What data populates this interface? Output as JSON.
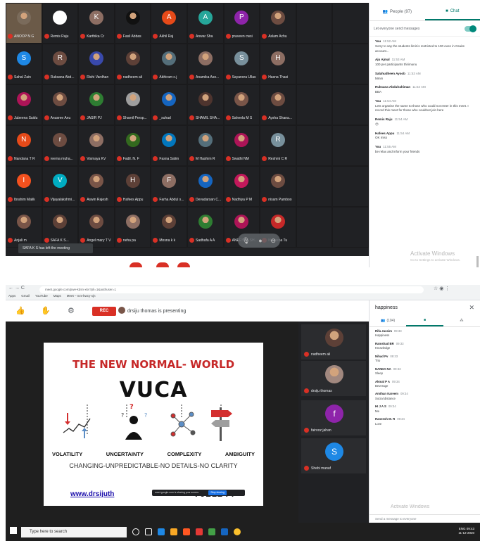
{
  "top": {
    "participants": [
      {
        "name": "ANOOP N G",
        "initial": "",
        "color": "#7a6b5b",
        "photo": true
      },
      {
        "name": "Remis Raju",
        "initial": "",
        "color": "#ffffff",
        "photo": false
      },
      {
        "name": "Karthika Cr",
        "initial": "K",
        "color": "#8d6e63",
        "photo": false
      },
      {
        "name": "Fasil Abbas",
        "initial": "",
        "color": "#111111",
        "photo": true
      },
      {
        "name": "Akhil Raj",
        "initial": "A",
        "color": "#e64a19",
        "photo": false
      },
      {
        "name": "Anwar Sha",
        "initial": "A",
        "color": "#26a69a",
        "photo": false
      },
      {
        "name": "praveen cwsi",
        "initial": "P",
        "color": "#8e24aa",
        "photo": false
      },
      {
        "name": "Aslam Achu",
        "initial": "",
        "color": "#6d4c41",
        "photo": true
      },
      {
        "name": "",
        "initial": "",
        "color": "#202124",
        "photo": false
      },
      {
        "name": "",
        "initial": "",
        "color": "#202124",
        "photo": false
      },
      {
        "name": "Sahal Zain",
        "initial": "S",
        "color": "#1e88e5",
        "photo": false
      },
      {
        "name": "Ruksana Abd...",
        "initial": "R",
        "color": "#6d4c41",
        "photo": false
      },
      {
        "name": "Rishi Vardhan",
        "initial": "",
        "color": "#3949ab",
        "photo": true
      },
      {
        "name": "nadheem ali",
        "initial": "",
        "color": "#5d4037",
        "photo": true
      },
      {
        "name": "Abhiram c.j",
        "initial": "",
        "color": "#546e7a",
        "photo": true
      },
      {
        "name": "Anamika Aso...",
        "initial": "",
        "color": "#8d6e63",
        "photo": true
      },
      {
        "name": "Sayanora Ullas",
        "initial": "S",
        "color": "#78909c",
        "photo": false
      },
      {
        "name": "Hasna Thasi",
        "initial": "H",
        "color": "#8d6e63",
        "photo": false
      },
      {
        "name": "",
        "initial": "",
        "color": "#202124",
        "photo": false
      },
      {
        "name": "",
        "initial": "",
        "color": "#202124",
        "photo": false
      },
      {
        "name": "Jubeena Saidu",
        "initial": "",
        "color": "#ad1457",
        "photo": true
      },
      {
        "name": "Anusree Anu",
        "initial": "",
        "color": "#6d4c41",
        "photo": true
      },
      {
        "name": "JASIR PJ",
        "initial": "",
        "color": "#2e7d32",
        "photo": true
      },
      {
        "name": "Shamil Persp...",
        "initial": "",
        "color": "#9e9e9e",
        "photo": true
      },
      {
        "name": "_suhad",
        "initial": "",
        "color": "#1565c0",
        "photo": true
      },
      {
        "name": "SHAMIL SHA...",
        "initial": "",
        "color": "#4e342e",
        "photo": true
      },
      {
        "name": "Saheela M S",
        "initial": "",
        "color": "#795548",
        "photo": true
      },
      {
        "name": "Aysha Shana...",
        "initial": "",
        "color": "#6d4c41",
        "photo": true
      },
      {
        "name": "",
        "initial": "",
        "color": "#202124",
        "photo": false
      },
      {
        "name": "",
        "initial": "",
        "color": "#202124",
        "photo": false
      },
      {
        "name": "Nandana T R",
        "initial": "N",
        "color": "#e64a19",
        "photo": false
      },
      {
        "name": "reema muha...",
        "initial": "r",
        "color": "#6d4c41",
        "photo": false
      },
      {
        "name": "Vismaya KV",
        "initial": "",
        "color": "#8d6e63",
        "photo": true
      },
      {
        "name": "Fadil. N. F",
        "initial": "",
        "color": "#33691e",
        "photo": true
      },
      {
        "name": "Fasna Salim",
        "initial": "",
        "color": "#0277bd",
        "photo": true
      },
      {
        "name": "M Hashim R",
        "initial": "",
        "color": "#546e7a",
        "photo": true
      },
      {
        "name": "Swathi NM",
        "initial": "",
        "color": "#ad1457",
        "photo": true
      },
      {
        "name": "Reshmi C R",
        "initial": "R",
        "color": "#78909c",
        "photo": false
      },
      {
        "name": "",
        "initial": "",
        "color": "#202124",
        "photo": false
      },
      {
        "name": "",
        "initial": "",
        "color": "#202124",
        "photo": false
      },
      {
        "name": "Ibrahim Malik",
        "initial": "I",
        "color": "#f4511e",
        "photo": false
      },
      {
        "name": "Vijayalakshmi...",
        "initial": "V",
        "color": "#00acc1",
        "photo": false
      },
      {
        "name": "Aswin Rajesh",
        "initial": "",
        "color": "#795548",
        "photo": true
      },
      {
        "name": "Hafees Appu",
        "initial": "H",
        "color": "#5d4037",
        "photo": false
      },
      {
        "name": "Farha Abdul s...",
        "initial": "F",
        "color": "#8d6e63",
        "photo": false
      },
      {
        "name": "Devadarsan C...",
        "initial": "",
        "color": "#1565c0",
        "photo": true
      },
      {
        "name": "Nadhiya P M",
        "initial": "",
        "color": "#c2185b",
        "photo": true
      },
      {
        "name": "nisam Pamboo",
        "initial": "",
        "color": "#6d4c41",
        "photo": true
      },
      {
        "name": "",
        "initial": "",
        "color": "#202124",
        "photo": false
      },
      {
        "name": "",
        "initial": "",
        "color": "#202124",
        "photo": false
      },
      {
        "name": "Anjali m",
        "initial": "",
        "color": "#795548",
        "photo": true
      },
      {
        "name": "SAFA K S...",
        "initial": "",
        "color": "#5d4037",
        "photo": true
      },
      {
        "name": "Angel mary T V",
        "initial": "",
        "color": "#6d4c41",
        "photo": true
      },
      {
        "name": "neha pa",
        "initial": "",
        "color": "#8d6e63",
        "photo": true
      },
      {
        "name": "Mosna k k",
        "initial": "",
        "color": "#5d4037",
        "photo": true
      },
      {
        "name": "Sadhafa A A",
        "initial": "",
        "color": "#2e7d32",
        "photo": true
      },
      {
        "name": "ANEESHA SH...",
        "initial": "",
        "color": "#ad1457",
        "photo": true
      },
      {
        "name": "Naveena Tu",
        "initial": "",
        "color": "#c62828",
        "photo": true
      },
      {
        "name": "",
        "initial": "",
        "color": "#202124",
        "photo": false
      },
      {
        "name": "",
        "initial": "",
        "color": "#202124",
        "photo": false
      }
    ],
    "toast": "SAFA K S has left the meeting",
    "chat": {
      "tab_people": "People (97)",
      "tab_chat": "Chat",
      "toggle_label": "Let everyone send messages",
      "messages": [
        {
          "who": "You",
          "time": "11:52 AM",
          "text": "Sorry to say the students limit is restricted to 100 even in Gsuite account..."
        },
        {
          "who": "Aju Ajmal",
          "time": "11:53 AM",
          "text": "100 per participants thirimunu"
        },
        {
          "who": "Salahudheen Ayoob",
          "time": "11:53 AM",
          "text": "Mmm"
        },
        {
          "who": "Ruksana Abdulrahiman",
          "time": "11:54 AM",
          "text": "BBA"
        },
        {
          "who": "You",
          "time": "11:54 AM",
          "text": "Lets organise the same to those who could not enter in this meet. I record this meet for those who couldnot join here"
        },
        {
          "who": "Remis Raju",
          "time": "11:54 AM",
          "text": "😊"
        },
        {
          "who": "Hafees Appu",
          "time": "11:54 AM",
          "text": "OK miss"
        },
        {
          "who": "You",
          "time": "11:55 AM",
          "text": "be relax and inform your friends"
        }
      ],
      "watermark_title": "Activate Windows",
      "watermark_sub": "Go to Settings to activate Windows."
    }
  },
  "bottom": {
    "url": "meet.google.com/pwe-kdsn-xkv?pli=1&authuser=1",
    "bookmarks": [
      "Apps",
      "Gmail",
      "YouTube",
      "Maps",
      "Meet – nvx-kwcy-xjn"
    ],
    "rec_label": "REC",
    "presenting": "drsiju thomas is presenting",
    "slide": {
      "title": "THE NEW NORMAL- WORLD",
      "vuca": "VUCA",
      "terms": [
        "VOLATILITY",
        "UNCERTAINTY",
        "COMPLEXITY",
        "AMBIGUITY"
      ],
      "subtitle": "CHANGING-UNPREDICTABLE-NO DETAILS-NO CLARITY",
      "url": "www.drsijuth",
      "number": "7921244",
      "share_text": "meet.google.com is sharing your screen.",
      "share_button": "Stop sharing"
    },
    "side_tiles": [
      {
        "name": "nadheem ali",
        "initial": "",
        "color": "#5d4037",
        "photo": true
      },
      {
        "name": "drsiju thomas",
        "initial": "",
        "color": "#a1887f",
        "photo": true
      },
      {
        "name": "fairooz jahan",
        "initial": "f",
        "color": "#8e24aa",
        "photo": false
      },
      {
        "name": "Shebi manaf",
        "initial": "S",
        "color": "#1e88e5",
        "photo": false
      }
    ],
    "panel": {
      "title": "happiness",
      "people_count": "(104)",
      "messages": [
        {
          "who": "Rifa Jassim",
          "time": "09:33",
          "text": "Happiness"
        },
        {
          "who": "Ramshad BR",
          "time": "09:33",
          "text": "Knowledge"
        },
        {
          "who": "Nihad Pv",
          "time": "09:33",
          "text": "Trio"
        },
        {
          "who": "NANDA NA",
          "time": "09:33",
          "text": "Sleep"
        },
        {
          "who": "Akmal P A",
          "time": "09:34",
          "text": "Beverage"
        },
        {
          "who": "Amthan Kareem",
          "time": "09:34",
          "text": "Social distance"
        },
        {
          "who": "HI J A S",
          "time": "09:34",
          "text": "Me"
        },
        {
          "who": "Raneesh M. R",
          "time": "09:34",
          "text": "Love"
        }
      ],
      "send_placeholder": "Send a message to everyone",
      "watermark_title": "Activate Windows",
      "watermark_sub": "Go to Settings to activate Windows."
    },
    "taskbar": {
      "search": "Type here to search",
      "time": "09:43",
      "date": "11-12-2020",
      "lang": "ENG"
    }
  }
}
